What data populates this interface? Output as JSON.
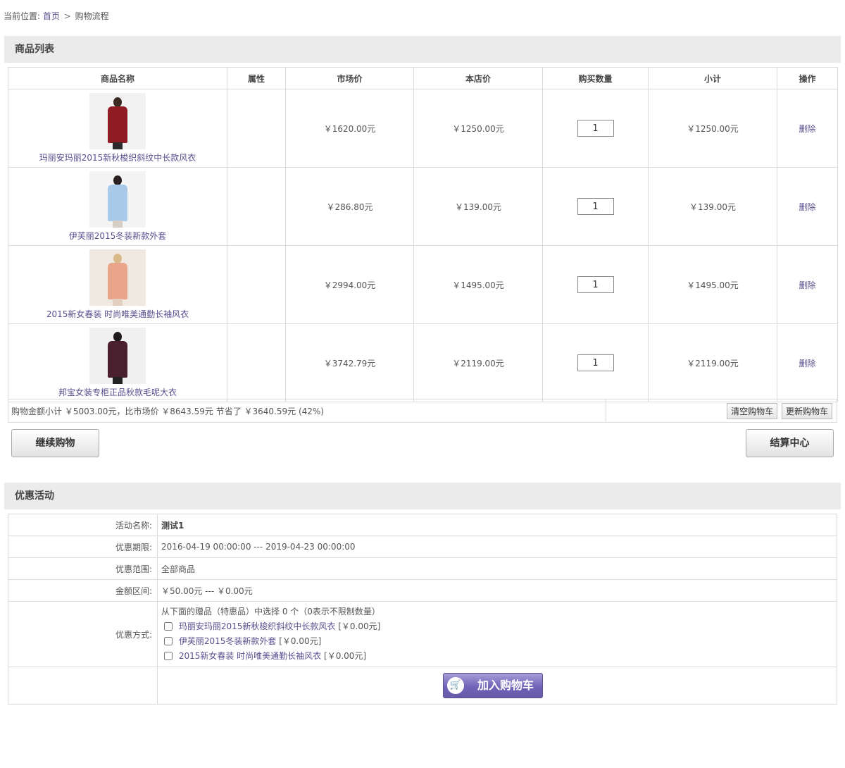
{
  "breadcrumb": {
    "prefix": "当前位置:",
    "home": "首页",
    "sep": ">",
    "current": "购物流程"
  },
  "cart_section_title": "商品列表",
  "columns": [
    "商品名称",
    "属性",
    "市场价",
    "本店价",
    "购买数量",
    "小计",
    "操作"
  ],
  "items": [
    {
      "name": "玛丽安玛丽2015新秋梭织斜纹中长款风衣",
      "attr": "",
      "market_price": "￥1620.00元",
      "shop_price": "￥1250.00元",
      "qty": "1",
      "subtotal": "￥1250.00元",
      "action": "删除",
      "thumb_bg": "#f2f2f2",
      "coat": "#8f1c24",
      "hair": "#3a2a22",
      "legs": "#2c2c2c"
    },
    {
      "name": "伊芙丽2015冬装新款外套",
      "attr": "",
      "market_price": "￥286.80元",
      "shop_price": "￥139.00元",
      "qty": "1",
      "subtotal": "￥139.00元",
      "action": "删除",
      "thumb_bg": "#f4f4f4",
      "coat": "#a9c9e8",
      "hair": "#2a2020",
      "legs": "#d6cfc5"
    },
    {
      "name": "2015新女春装 时尚唯美通勤长袖风衣",
      "attr": "",
      "market_price": "￥2994.00元",
      "shop_price": "￥1495.00元",
      "qty": "1",
      "subtotal": "￥1495.00元",
      "action": "删除",
      "thumb_bg": "#efe9e2",
      "coat": "#e8a58a",
      "hair": "#d9b98a",
      "legs": "#e3cfc0"
    },
    {
      "name": "邦宝女装专柜正品秋款毛呢大衣",
      "attr": "",
      "market_price": "￥3742.79元",
      "shop_price": "￥2119.00元",
      "qty": "1",
      "subtotal": "￥2119.00元",
      "action": "删除",
      "thumb_bg": "#f0f0f0",
      "coat": "#4a1f2e",
      "hair": "#1f1a1a",
      "legs": "#222222"
    }
  ],
  "summary": {
    "text": "购物金额小计 ￥5003.00元，比市场价 ￥8643.59元 节省了 ￥3640.59元 (42%)",
    "clear_cart": "清空购物车",
    "update_cart": "更新购物车"
  },
  "continue_shopping": "继续购物",
  "checkout": "结算中心",
  "promo_section_title": "优惠活动",
  "promo": {
    "name_label": "活动名称:",
    "name_value": "测试1",
    "period_label": "优惠期限:",
    "period_value": "2016-04-19 00:00:00 --- 2019-04-23 00:00:00",
    "scope_label": "优惠范围:",
    "scope_value": "全部商品",
    "amount_label": "金额区间:",
    "amount_value": "￥50.00元 --- ￥0.00元",
    "method_label": "优惠方式:",
    "method_intro": "从下面的赠品（特惠品）中选择 0 个（0表示不限制数量）",
    "gifts": [
      {
        "name": "玛丽安玛丽2015新秋梭织斜纹中长款风衣",
        "price": "[￥0.00元]"
      },
      {
        "name": "伊芙丽2015冬装新款外套",
        "price": "[￥0.00元]"
      },
      {
        "name": "2015新女春装 时尚唯美通勤长袖风衣",
        "price": "[￥0.00元]"
      }
    ],
    "add_to_cart": "加入购物车"
  }
}
